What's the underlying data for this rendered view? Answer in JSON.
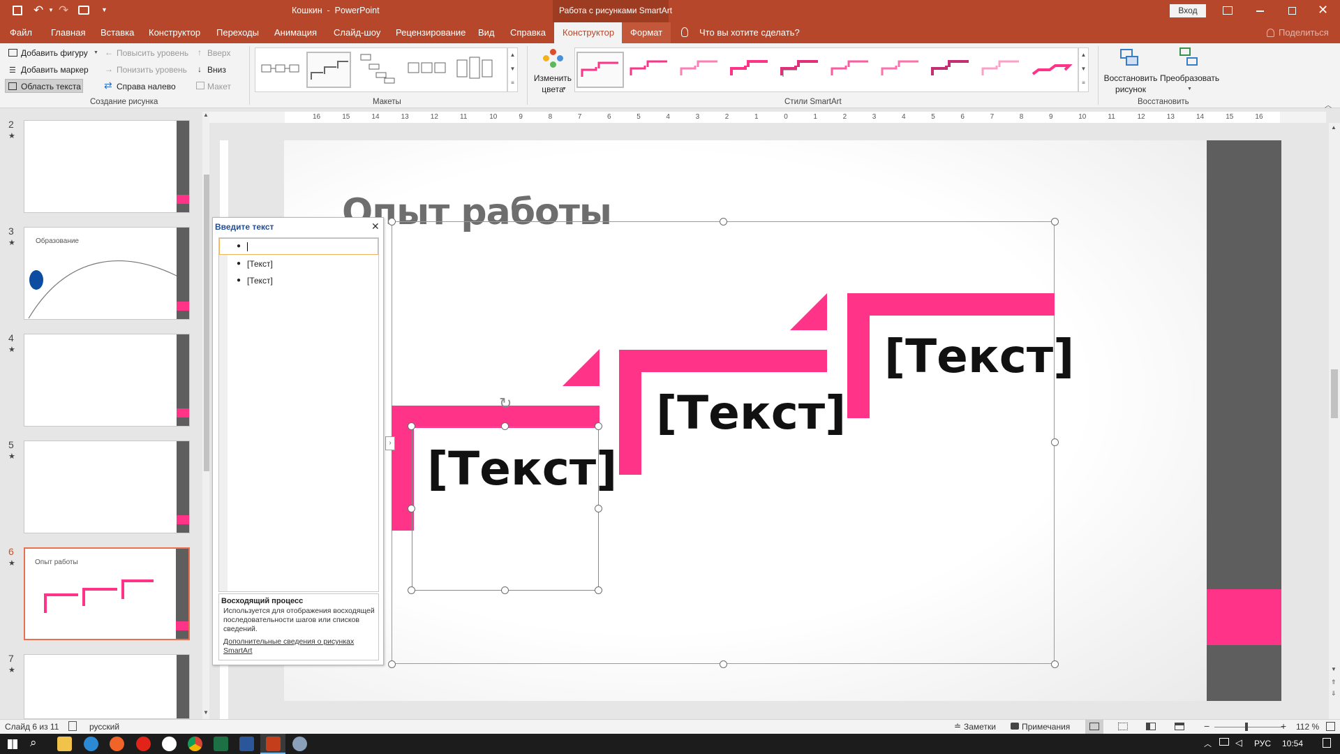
{
  "titlebar": {
    "document_title": "Кошкин  -  PowerPoint",
    "contextual_group": "Работа с рисунками SmartArt",
    "signin_button": "Вход"
  },
  "tabs": [
    "Файл",
    "Главная",
    "Вставка",
    "Конструктор",
    "Переходы",
    "Анимация",
    "Слайд-шоу",
    "Рецензирование",
    "Вид",
    "Справка",
    "Конструктор",
    "Формат"
  ],
  "tell_me": "Что вы хотите сделать?",
  "share": "Поделиться",
  "ribbon": {
    "create_graphic": {
      "add_shape": "Добавить фигуру",
      "add_bullet": "Добавить маркер",
      "text_pane": "Область текста",
      "promote": "Повысить уровень",
      "demote": "Понизить уровень",
      "right_to_left": "Справа налево",
      "move_up": "Вверх",
      "move_down": "Вниз",
      "layout": "Макет",
      "label": "Создание рисунка"
    },
    "layouts_label": "Макеты",
    "change_colors": "Изменить цвета",
    "styles_label": "Стили SmartArt",
    "reset_graphic": "Восстановить рисунок",
    "convert": "Преобразовать",
    "reset_label": "Восстановить"
  },
  "slides": [
    {
      "num": "2",
      "title": ""
    },
    {
      "num": "3",
      "title": "Образование"
    },
    {
      "num": "4",
      "title": ""
    },
    {
      "num": "5",
      "title": ""
    },
    {
      "num": "6",
      "title": "Опыт работы"
    },
    {
      "num": "7",
      "title": ""
    }
  ],
  "ruler": {
    "horizontal": [
      "16",
      "15",
      "14",
      "13",
      "12",
      "11",
      "10",
      "9",
      "8",
      "7",
      "6",
      "5",
      "4",
      "3",
      "2",
      "1",
      "0",
      "1",
      "2",
      "3",
      "4",
      "5",
      "6",
      "7",
      "8",
      "9",
      "10",
      "11",
      "12",
      "13",
      "14",
      "15",
      "16"
    ]
  },
  "slide": {
    "title": "Опыт работы",
    "items": [
      "[Текст]",
      "[Текст]",
      "[Текст]"
    ]
  },
  "text_pane": {
    "title": "Введите текст",
    "bullets": [
      "",
      "[Текст]",
      "[Текст]"
    ],
    "desc_title": "Восходящий процесс",
    "desc_body": "Используется для отображения восходящей последовательности шагов или списков сведений.",
    "desc_link": "Дополнительные сведения о рисунках SmartArt"
  },
  "status": {
    "slide_of": "Слайд 6 из 11",
    "language": "русский",
    "notes": "Заметки",
    "comments": "Примечания",
    "zoom": "112 %"
  },
  "taskbar": {
    "lang": "РУС",
    "time": "10:54"
  },
  "colors": {
    "accent": "#b7472a",
    "smartart_pink": "#ff3488",
    "sidebar_gray": "#5e5e5e"
  }
}
